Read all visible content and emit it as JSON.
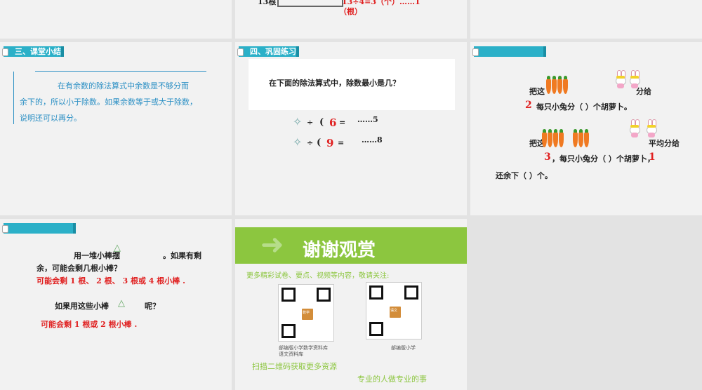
{
  "slide1": {
    "top_partial": "13根",
    "formula_partial": "13÷4=3（个）……1",
    "formula_unit": "（根）"
  },
  "slide4": {
    "tag": "三、课堂小结",
    "line1": "在有余数的除法算式中余数是不够分而",
    "line2": "余下的，所以小于除数。如果余数等于或大于除数，",
    "line3": "说明还可以再分。"
  },
  "slide5": {
    "tag": "四、巩固练习",
    "question": "在下面的除法算式中，除数最小是几？",
    "eq1": {
      "div": "÷",
      "paren": "(",
      "answer": "6",
      "eq": "=",
      "rem": "……5"
    },
    "eq2": {
      "div": "÷",
      "paren": "(",
      "answer": "9",
      "eq": "=",
      "rem": "……8"
    }
  },
  "slide6": {
    "tag": "",
    "p1_start": "把这",
    "p1_end": "分给",
    "p1_ans": "2",
    "p1_line": "每只小兔分（        ）个胡萝卜。",
    "p2_start": "把这",
    "p2_end": "平均分给",
    "p2_ans": "3",
    "p2_line": "，每只小兔分（        ）个胡萝卜，",
    "p2_ans2": "1",
    "p2_line2": "还余下（        ）个。"
  },
  "slide7": {
    "tag": "",
    "q1a": "用一堆小棒摆",
    "q1b": "。如果有剩",
    "q1c": "余，可能会剩几根小棒？",
    "a1": "可能会剩 1 根、 2 根、 3 根或 4 根小棒 .",
    "q2a": "如果用这些小棒",
    "q2b": "呢？",
    "a2": "可能会剩 1 根或 2 根小棒 ."
  },
  "slide8": {
    "banner": "谢谢观赏",
    "follow": "更多精彩试卷、要点、视频等内容，敬请关注:",
    "qr1_caption": "部编版小学数学资料库",
    "qr1_caption2": "语文资料库",
    "qr2_caption": "部编版小学",
    "qr1_center": "数学",
    "qr2_center": "语文",
    "scan": "扫描二维码获取更多资源",
    "slogan": "专业的人做专业的事"
  },
  "colors": {
    "accent": "#2bb0c8",
    "banner": "#8cc63f",
    "red": "#e02020",
    "blue": "#2a8fc4"
  }
}
